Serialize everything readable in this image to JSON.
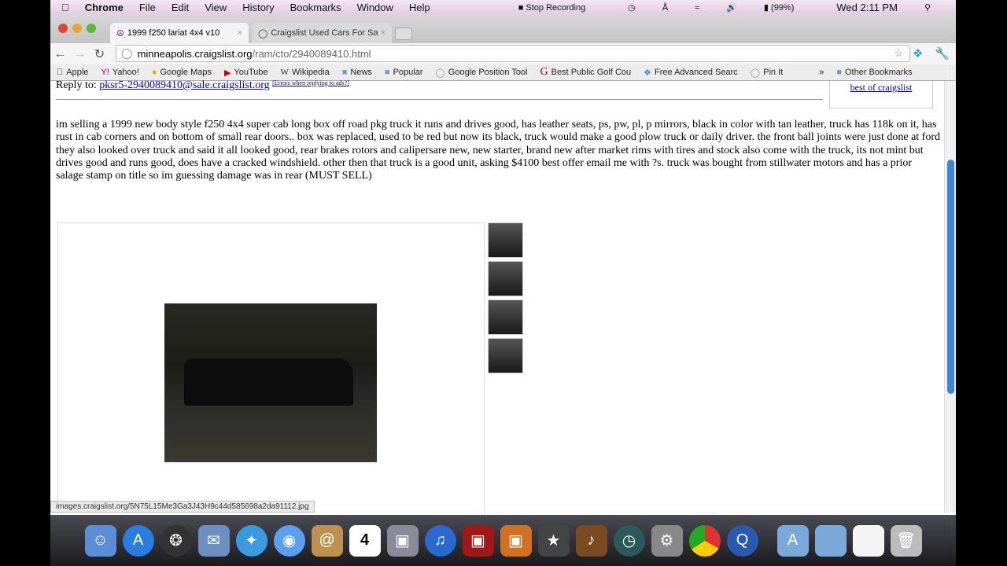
{
  "menubar": {
    "app": "Chrome",
    "items": [
      "File",
      "Edit",
      "View",
      "History",
      "Bookmarks",
      "Window",
      "Help"
    ],
    "recording": "Stop Recording",
    "battery": "(99%)",
    "clock": "Wed 2:11 PM"
  },
  "tabs": [
    {
      "title": "1999 f250 lariat 4x4 v10"
    },
    {
      "title": "Craigslist Used Cars For Sale"
    }
  ],
  "address": {
    "host": "minneapolis.craigslist.org",
    "path": "/ram/cto/2940089410.html"
  },
  "bookmarks": [
    "Apple",
    "Yahoo!",
    "Google Maps",
    "YouTube",
    "Wikipedia",
    "News",
    "Popular",
    "Google Position Tool",
    "Best Public Golf Cou",
    "Free Advanced Searc",
    "Pin It"
  ],
  "other_bookmarks": "Other Bookmarks",
  "page": {
    "reply_label": "Reply to:",
    "reply_email": "pksr5-2940089410@sale.craigslist.org",
    "errors_link": "[Errors when replying to ads?]",
    "best_of": "best of craigslist",
    "body": "im selling a 1999 new body style f250 4x4 super cab long box off road pkg truck it runs and drives good, has leather seats, ps, pw, pl, p mirrors, black in color with tan leather, truck has 118k on it, has rust in cab corners and on bottom of small rear doors.. box was replaced, used to be red but now its black, truck would make a good plow truck or daily driver. the front ball joints were just done at ford they also looked over truck and said it all looked good, rear brakes rotors and calipersare new, new starter, brand new after market rims with tires and stock also come with the truck, its not mint but drives good and runs good, does have a cracked windshield. other then that truck is a good unit, asking $4100 best offer email me with ?s. truck was bought from stillwater motors and has a prior salage stamp on title so im guessing damage was in rear (MUST SELL)"
  },
  "status_url": "images.craigslist.org/5N75L15Me3Ga3J43H9c44d585698a2da91112.jpg",
  "dock_calendar_day": "4"
}
